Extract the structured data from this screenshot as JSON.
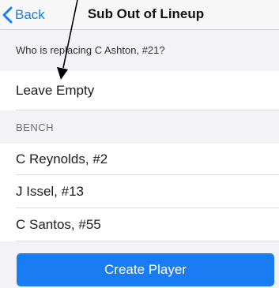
{
  "navbar": {
    "back_label": "Back",
    "title": "Sub Out of Lineup",
    "back_icon": "chevron-left-icon"
  },
  "question": "Who is replacing C Ashton, #21?",
  "options": {
    "leave_empty": "Leave Empty"
  },
  "bench": {
    "header": "BENCH",
    "players": [
      {
        "label": "C Reynolds, #2"
      },
      {
        "label": "J Issel, #13"
      },
      {
        "label": "C Santos, #55"
      }
    ]
  },
  "actions": {
    "create_player": "Create Player"
  },
  "annotation": {
    "icon": "annotation-arrow-icon",
    "color": "#000000"
  },
  "colors": {
    "accent": "#1a7cf3",
    "background": "#f2f2f7",
    "row_background": "#ffffff"
  }
}
